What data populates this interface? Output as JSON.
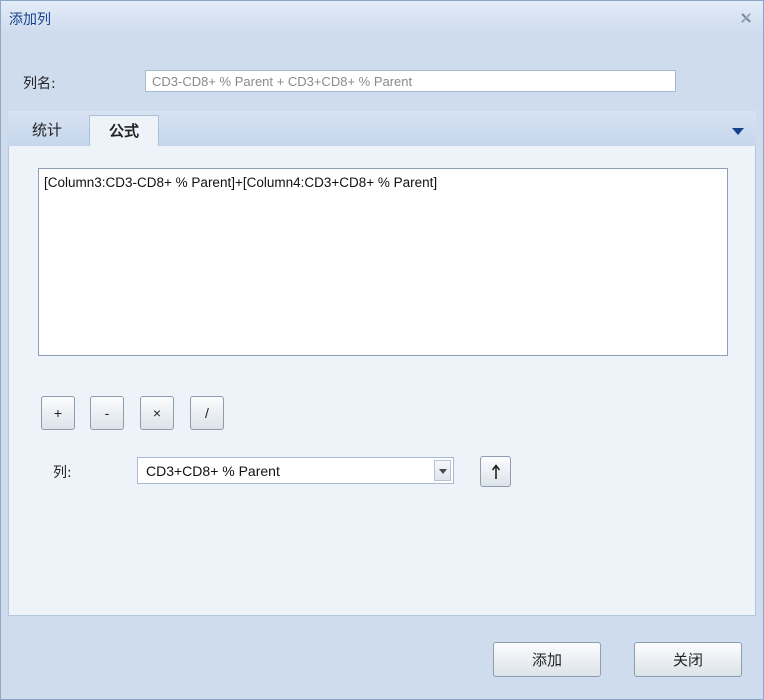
{
  "window": {
    "title": "添加列",
    "close_icon": "close-icon"
  },
  "name_field": {
    "label": "列名:",
    "value": "CD3-CD8+ % Parent + CD3+CD8+ % Parent"
  },
  "tabs": [
    {
      "label": "统计",
      "active": false
    },
    {
      "label": "公式",
      "active": true
    }
  ],
  "formula": {
    "text": "[Column3:CD3-CD8+ % Parent]+[Column4:CD3+CD8+ % Parent]"
  },
  "operators": [
    "+",
    "-",
    "×",
    "/"
  ],
  "column_selector": {
    "label": "列:",
    "selected": "CD3+CD8+ % Parent"
  },
  "buttons": {
    "add": "添加",
    "close": "关闭"
  },
  "colors": {
    "title_text": "#15428b",
    "panel_bg": "#eef3fa",
    "dialog_bg": "#cfdcee"
  }
}
